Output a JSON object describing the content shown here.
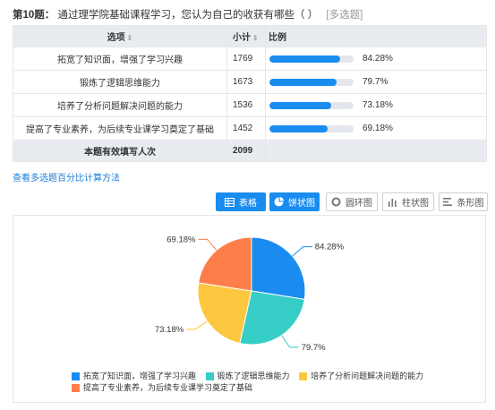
{
  "question": {
    "number": "第10题：",
    "text": "通过理学院基础课程学习，您认为自己的收获有哪些（ ）",
    "type": "[多选题]"
  },
  "table": {
    "headers": {
      "option": "选项",
      "count": "小计",
      "percent": "比例"
    },
    "sort_icon": "sort-icon",
    "rows": [
      {
        "option": "拓宽了知识面，增强了学习兴趣",
        "count": "1769",
        "percent": "84.28%",
        "value": 84.28
      },
      {
        "option": "锻炼了逻辑思维能力",
        "count": "1673",
        "percent": "79.7%",
        "value": 79.7
      },
      {
        "option": "培养了分析问题解决问题的能力",
        "count": "1536",
        "percent": "73.18%",
        "value": 73.18
      },
      {
        "option": "提高了专业素养，为后续专业课学习奠定了基础",
        "count": "1452",
        "percent": "69.18%",
        "value": 69.18
      }
    ],
    "total_label": "本题有效填写人次",
    "total_value": "2099"
  },
  "calc_link": "查看多选题百分比计算方法",
  "view_buttons": {
    "table": "表格",
    "pie": "饼状图",
    "ring": "圆环图",
    "column": "柱状图",
    "bar": "条形图"
  },
  "colors": {
    "accent": "#1a8cf0",
    "slice1": "#1a8cf0",
    "slice2": "#36cdc6",
    "slice3": "#fdc83f",
    "slice4": "#fd7e48"
  },
  "chart_data": {
    "type": "pie",
    "series": [
      {
        "name": "拓宽了知识面，增强了学习兴趣",
        "label": "84.28%",
        "value": 1769
      },
      {
        "name": "锻炼了逻辑思维能力",
        "label": "79.7%",
        "value": 1673
      },
      {
        "name": "培养了分析问题解决问题的能力",
        "label": "73.18%",
        "value": 1536
      },
      {
        "name": "提高了专业素养，为后续专业课学习奠定了基础",
        "label": "69.18%",
        "value": 1452
      }
    ],
    "legend_position": "bottom"
  }
}
